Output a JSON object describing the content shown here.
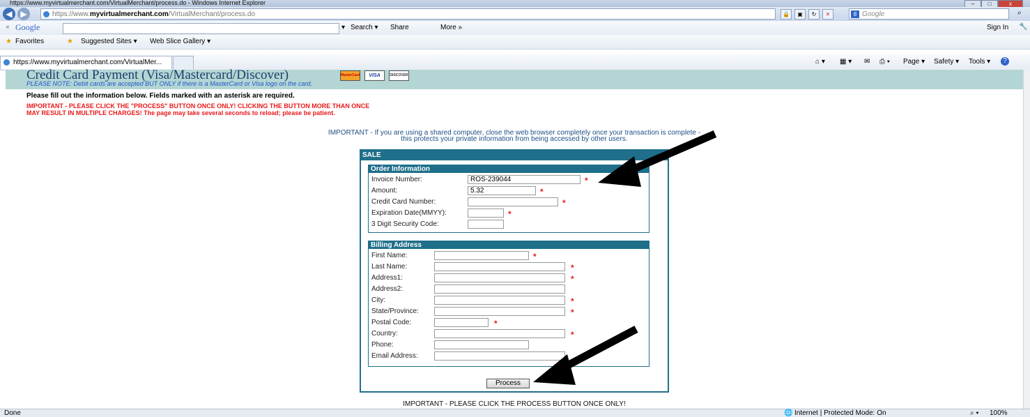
{
  "window": {
    "title": "https://www.myvirtualmerchant.com/VirtualMerchant/process.do - Windows Internet Explorer",
    "min": "–",
    "max": "□",
    "close": "x"
  },
  "address": {
    "prefix": "https://www.",
    "domain": "myvirtualmerchant.com",
    "path": "/VirtualMerchant/process.do",
    "search_engine": "Google",
    "search_placeholder": "Google"
  },
  "google_toolbar": {
    "close": "×",
    "logo": "Google",
    "search": "Search ▾",
    "share": "Share",
    "more": "More »",
    "signin": "Sign In"
  },
  "favorites_bar": {
    "favorites": "Favorites",
    "suggested": "Suggested Sites ▾",
    "gallery": "Web Slice Gallery ▾"
  },
  "tab": {
    "label": "https://www.myvirtualmerchant.com/VirtualMer...",
    "page": "Page ▾",
    "safety": "Safety ▾",
    "tools": "Tools ▾",
    "help": "?"
  },
  "page": {
    "title": "Credit Card Payment (Visa/Mastercard/Discover)",
    "note": "PLEASE NOTE: Debit cards are accepted BUT ONLY if there is a MasterCard or Visa logo on the card.",
    "cards": [
      "MasterCard",
      "VISA",
      "DISCOVER"
    ],
    "fill_instructions": "Please fill out the information below. Fields marked with an asterisk are required.",
    "warning_line1": "IMPORTANT - PLEASE CLICK THE \"PROCESS\" BUTTON ONCE ONLY! CLICKING THE BUTTON MORE THAN ONCE",
    "warning_line2": "MAY RESULT IN MULTIPLE CHARGES! The page may take several seconds to reload; please be patient.",
    "shared_line1": "IMPORTANT - If you are using a shared computer, close the web browser completely once your transaction is complete -",
    "shared_line2": "this protects your private information from being accessed by other users.",
    "sale_header": "SALE",
    "order_header": "Order Information",
    "billing_header": "Billing Address",
    "process_button": "Process",
    "bottom_notice": "IMPORTANT - PLEASE CLICK THE PROCESS BUTTON ONCE ONLY!"
  },
  "order_fields": {
    "invoice": {
      "label": "Invoice Number:",
      "value": "ROS-239044"
    },
    "amount": {
      "label": "Amount:",
      "value": "5.32"
    },
    "card_number": {
      "label": "Credit Card Number:",
      "value": ""
    },
    "expiration": {
      "label": "Expiration Date(MMYY):",
      "value": ""
    },
    "security": {
      "label": "3 Digit Security Code:",
      "value": ""
    }
  },
  "billing_fields": {
    "first_name": {
      "label": "First Name:",
      "value": ""
    },
    "last_name": {
      "label": "Last Name:",
      "value": ""
    },
    "address1": {
      "label": "Address1:",
      "value": ""
    },
    "address2": {
      "label": "Address2:",
      "value": ""
    },
    "city": {
      "label": "City:",
      "value": ""
    },
    "state": {
      "label": "State/Province:",
      "value": ""
    },
    "postal": {
      "label": "Postal Code:",
      "value": ""
    },
    "country": {
      "label": "Country:",
      "value": ""
    },
    "phone": {
      "label": "Phone:",
      "value": ""
    },
    "email": {
      "label": "Email Address:",
      "value": ""
    }
  },
  "required_marker": "*",
  "status": {
    "left": "Done",
    "zone": "Internet | Protected Mode: On",
    "zoom": "100%"
  },
  "colors": {
    "header_bg": "#b3d6d4",
    "form_border": "#1f6f8a",
    "warning": "#e8191b",
    "title": "#1c3e6e"
  }
}
